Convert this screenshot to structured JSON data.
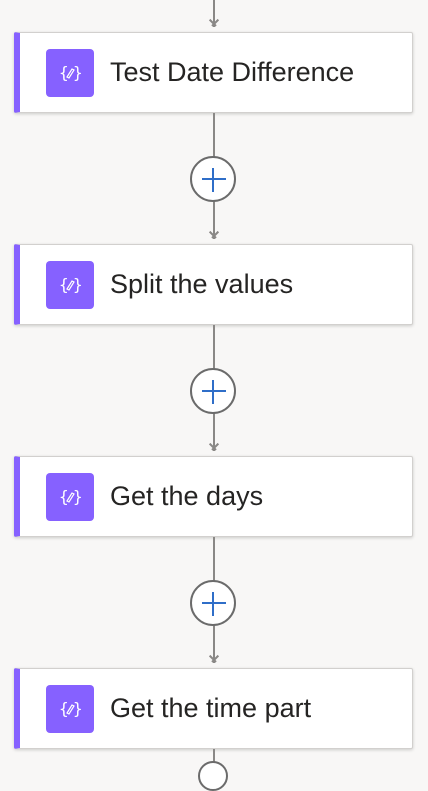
{
  "flow": {
    "steps": [
      {
        "title": "Test Date Difference",
        "icon": "variable-icon"
      },
      {
        "title": "Split the values",
        "icon": "variable-icon"
      },
      {
        "title": "Get the days",
        "icon": "variable-icon"
      },
      {
        "title": "Get the time part",
        "icon": "variable-icon"
      }
    ]
  },
  "colors": {
    "accent": "#8661ff",
    "plus": "#2f6ec8",
    "connector": "#8a8886",
    "background": "#f8f7f6"
  }
}
